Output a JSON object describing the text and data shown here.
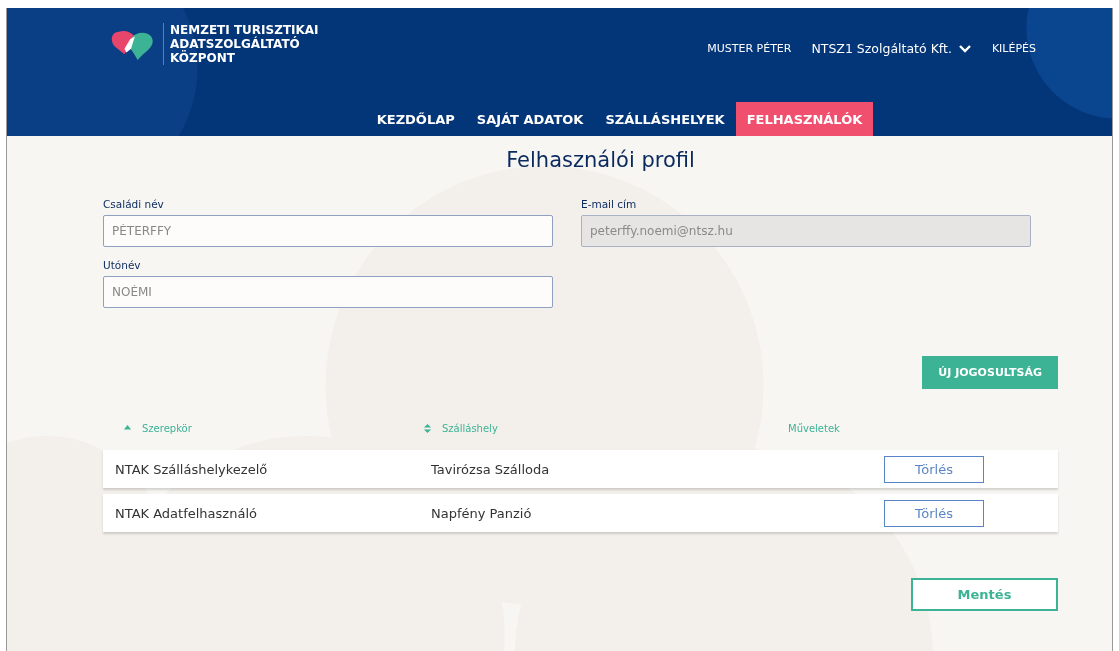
{
  "header": {
    "brand": [
      "NEMZETI TURISZTIKAI",
      "ADATSZOLGÁLTATÓ",
      "KÖZPONT"
    ],
    "user": "MUSTER PÉTER",
    "company": "NTSZ1 Szolgáltató Kft.",
    "logout": "KILÉPÉS"
  },
  "nav": [
    {
      "label": "KEZDŐLAP",
      "selected": false
    },
    {
      "label": "SAJÁT ADATOK",
      "selected": false
    },
    {
      "label": "SZÁLLÁSHELYEK",
      "selected": false
    },
    {
      "label": "FELHASZNÁLÓK",
      "selected": true
    }
  ],
  "page_title": "Felhasználói profil",
  "fields": [
    {
      "label": "Családi név",
      "value": "PÉTERFFY",
      "disabled": false
    },
    {
      "label": "E-mail cím",
      "value": "peterffy.noemi@ntsz.hu",
      "disabled": true
    },
    {
      "label": "Utónév",
      "value": "NOÉMI",
      "disabled": false
    }
  ],
  "new_button": "ÚJ JOGOSULTSÁG",
  "table": {
    "columns": [
      {
        "label": "Szerepkör",
        "kind": "sorted"
      },
      {
        "label": "Szálláshely",
        "kind": "sortable"
      },
      {
        "label": "Műveletek",
        "kind": "plain"
      }
    ],
    "rows": [
      {
        "role": "NTAK Szálláshelykezelő",
        "place": "Tavirózsa Szálloda",
        "action": "Törlés"
      },
      {
        "role": "NTAK Adatfelhasználó",
        "place": "Napfény Panzió",
        "action": "Törlés"
      }
    ]
  },
  "save_button": "Mentés"
}
